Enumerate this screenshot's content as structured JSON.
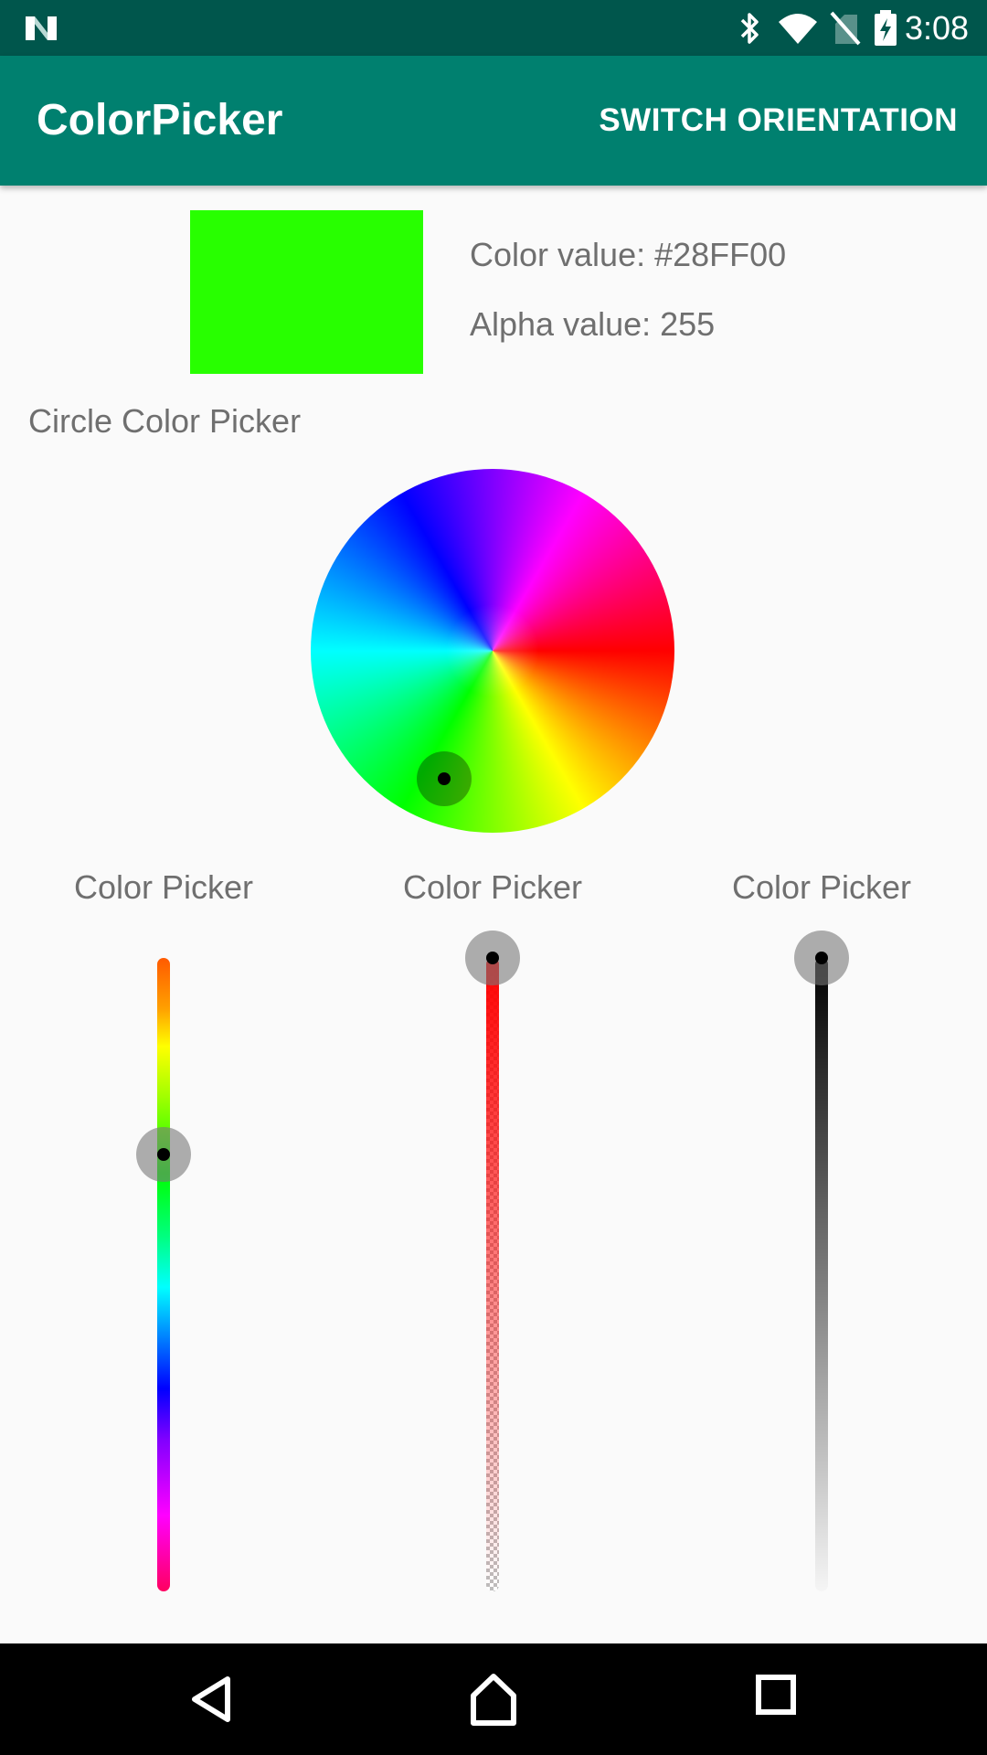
{
  "status_bar": {
    "time": "3:08",
    "icons": [
      "n-logo-icon",
      "bluetooth-icon",
      "wifi-icon",
      "no-signal-icon",
      "battery-charging-icon"
    ]
  },
  "app_bar": {
    "title": "ColorPicker",
    "action_label": "SWITCH ORIENTATION",
    "background": "#00806f"
  },
  "preview": {
    "color": "#28FF00",
    "color_value_text": "Color value: #28FF00",
    "alpha_value_text": "Alpha value: 255"
  },
  "circle_picker": {
    "title": "Circle Color Picker"
  },
  "sliders": [
    {
      "title": "Color Picker",
      "type": "hue",
      "position_fraction": 0.31
    },
    {
      "title": "Color Picker",
      "type": "alpha",
      "position_fraction": 0.0
    },
    {
      "title": "Color Picker",
      "type": "brightness",
      "position_fraction": 0.0
    }
  ],
  "nav_bar": {
    "icons": [
      "back-icon",
      "home-icon",
      "recents-icon"
    ]
  }
}
